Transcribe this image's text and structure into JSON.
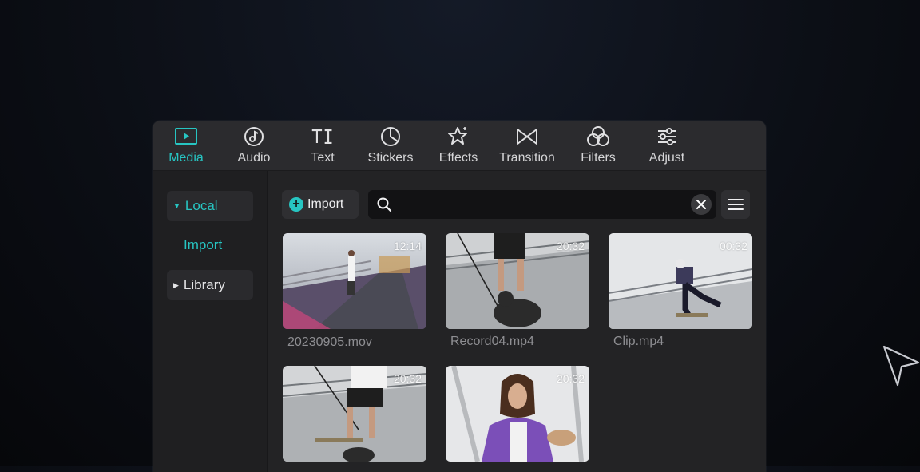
{
  "tabs": [
    {
      "label": "Media",
      "icon": "media-icon",
      "active": true
    },
    {
      "label": "Audio",
      "icon": "audio-icon",
      "active": false
    },
    {
      "label": "Text",
      "icon": "text-icon",
      "active": false
    },
    {
      "label": "Stickers",
      "icon": "stickers-icon",
      "active": false
    },
    {
      "label": "Effects",
      "icon": "effects-icon",
      "active": false
    },
    {
      "label": "Transition",
      "icon": "transition-icon",
      "active": false
    },
    {
      "label": "Filters",
      "icon": "filters-icon",
      "active": false
    },
    {
      "label": "Adjust",
      "icon": "adjust-icon",
      "active": false
    }
  ],
  "sidebar": {
    "items": [
      {
        "label": "Local",
        "expanded": true
      },
      {
        "label": "Import"
      },
      {
        "label": "Library",
        "expanded": false
      }
    ]
  },
  "toolbar": {
    "import_label": "Import",
    "search_placeholder": ""
  },
  "media": [
    {
      "duration": "12:14",
      "filename": "20230905.mov"
    },
    {
      "duration": "20:32",
      "filename": "Record04.mp4"
    },
    {
      "duration": "00:32",
      "filename": "Clip.mp4"
    },
    {
      "duration": "20:32",
      "filename": ""
    },
    {
      "duration": "20:32",
      "filename": ""
    }
  ],
  "colors": {
    "accent": "#27c5c2",
    "panel": "#252527",
    "background": "#0c0f16"
  }
}
